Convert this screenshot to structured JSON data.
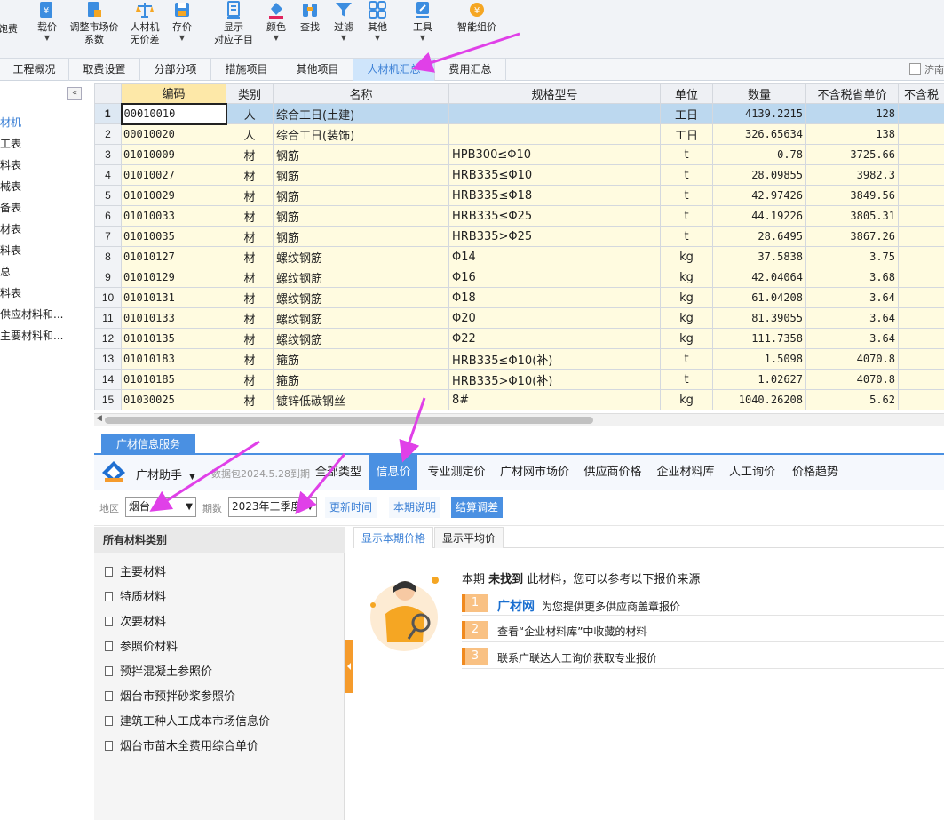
{
  "toolbar": {
    "items": [
      {
        "label": "饱费",
        "icon": "fee-icon"
      },
      {
        "label": "载价",
        "icon": "load-price-icon",
        "dropdown": true
      },
      {
        "label": "调整市场价\n系数",
        "icon": "adjust-coefficient-icon"
      },
      {
        "label": "人材机\n无价差",
        "icon": "balance-icon"
      },
      {
        "label": "存价",
        "icon": "save-price-icon",
        "dropdown": true
      },
      {
        "label": "显示\n对应子目",
        "icon": "show-items-icon"
      },
      {
        "label": "颜色",
        "icon": "color-bucket-icon",
        "dropdown": true
      },
      {
        "label": "查找",
        "icon": "binoculars-icon"
      },
      {
        "label": "过滤",
        "icon": "filter-icon",
        "dropdown": true
      },
      {
        "label": "其他",
        "icon": "grid-apps-icon",
        "dropdown": true
      },
      {
        "label": "工具",
        "icon": "tools-icon",
        "dropdown": true
      },
      {
        "label": "智能组价",
        "icon": "smart-price-icon"
      }
    ]
  },
  "tabs": [
    {
      "label": "工程概况"
    },
    {
      "label": "取费设置"
    },
    {
      "label": "分部分项"
    },
    {
      "label": "措施项目"
    },
    {
      "label": "其他项目"
    },
    {
      "label": "人材机汇总",
      "active": true
    },
    {
      "label": "费用汇总"
    }
  ],
  "tab_checkbox": "济南",
  "left_tree": [
    "材机",
    "工表",
    "料表",
    "械表",
    "备表",
    "材表",
    "料表",
    "总",
    "料表",
    "供应材料和...",
    "主要材料和..."
  ],
  "grid": {
    "headers": [
      "编码",
      "类别",
      "名称",
      "规格型号",
      "单位",
      "数量",
      "不含税省单价",
      "不含税"
    ],
    "rows": [
      {
        "n": "1",
        "code": "00010010",
        "type": "人",
        "name": "综合工日(土建)",
        "spec": "",
        "unit": "工日",
        "qty": "4139.2215",
        "price": "128"
      },
      {
        "n": "2",
        "code": "00010020",
        "type": "人",
        "name": "综合工日(装饰)",
        "spec": "",
        "unit": "工日",
        "qty": "326.65634",
        "price": "138"
      },
      {
        "n": "3",
        "code": "01010009",
        "type": "材",
        "name": "钢筋",
        "spec": "HPB300≤Φ10",
        "unit": "t",
        "qty": "0.78",
        "price": "3725.66"
      },
      {
        "n": "4",
        "code": "01010027",
        "type": "材",
        "name": "钢筋",
        "spec": "HRB335≤Φ10",
        "unit": "t",
        "qty": "28.09855",
        "price": "3982.3"
      },
      {
        "n": "5",
        "code": "01010029",
        "type": "材",
        "name": "钢筋",
        "spec": "HRB335≤Φ18",
        "unit": "t",
        "qty": "42.97426",
        "price": "3849.56"
      },
      {
        "n": "6",
        "code": "01010033",
        "type": "材",
        "name": "钢筋",
        "spec": "HRB335≤Φ25",
        "unit": "t",
        "qty": "44.19226",
        "price": "3805.31"
      },
      {
        "n": "7",
        "code": "01010035",
        "type": "材",
        "name": "钢筋",
        "spec": "HRB335>Φ25",
        "unit": "t",
        "qty": "28.6495",
        "price": "3867.26"
      },
      {
        "n": "8",
        "code": "01010127",
        "type": "材",
        "name": "螺纹钢筋",
        "spec": "Φ14",
        "unit": "kg",
        "qty": "37.5838",
        "price": "3.75"
      },
      {
        "n": "9",
        "code": "01010129",
        "type": "材",
        "name": "螺纹钢筋",
        "spec": "Φ16",
        "unit": "kg",
        "qty": "42.04064",
        "price": "3.68"
      },
      {
        "n": "10",
        "code": "01010131",
        "type": "材",
        "name": "螺纹钢筋",
        "spec": "Φ18",
        "unit": "kg",
        "qty": "61.04208",
        "price": "3.64"
      },
      {
        "n": "11",
        "code": "01010133",
        "type": "材",
        "name": "螺纹钢筋",
        "spec": "Φ20",
        "unit": "kg",
        "qty": "81.39055",
        "price": "3.64"
      },
      {
        "n": "12",
        "code": "01010135",
        "type": "材",
        "name": "螺纹钢筋",
        "spec": "Φ22",
        "unit": "kg",
        "qty": "111.7358",
        "price": "3.64"
      },
      {
        "n": "13",
        "code": "01010183",
        "type": "材",
        "name": "箍筋",
        "spec": "HRB335≤Φ10(补)",
        "unit": "t",
        "qty": "1.5098",
        "price": "4070.8"
      },
      {
        "n": "14",
        "code": "01010185",
        "type": "材",
        "name": "箍筋",
        "spec": "HRB335>Φ10(补)",
        "unit": "t",
        "qty": "1.02627",
        "price": "4070.8"
      },
      {
        "n": "15",
        "code": "01030025",
        "type": "材",
        "name": "镀锌低碳钢丝",
        "spec": "8#",
        "unit": "kg",
        "qty": "1040.26208",
        "price": "5.62"
      }
    ]
  },
  "guangcai": {
    "tab": "广材信息服务",
    "assistant": "广材助手",
    "expire": "数据包2024.5.28到期",
    "nav": [
      {
        "label": "全部类型"
      },
      {
        "label": "信息价",
        "active": true
      },
      {
        "label": "专业测定价"
      },
      {
        "label": "广材网市场价"
      },
      {
        "label": "供应商价格"
      },
      {
        "label": "企业材料库"
      },
      {
        "label": "人工询价"
      },
      {
        "label": "价格趋势"
      }
    ],
    "filter": {
      "region_label": "地区",
      "region": "烟台",
      "period_label": "期数",
      "period": "2023年三季度",
      "btn_update": "更新时间",
      "btn_notes": "本期说明",
      "btn_settle": "结算调差"
    },
    "categories_head": "所有材料类别",
    "categories": [
      "主要材料",
      "特质材料",
      "次要材料",
      "参照价材料",
      "预拌混凝土参照价",
      "烟台市预拌砂浆参照价",
      "建筑工种人工成本市场信息价",
      "烟台市苗木全费用综合单价"
    ],
    "price_tabs": [
      {
        "label": "显示本期价格",
        "active": true
      },
      {
        "label": "显示平均价"
      }
    ],
    "notfound": {
      "pre": "本期",
      "bold": "未找到",
      "post": "此材料，您可以参考以下报价来源"
    },
    "options": [
      {
        "num": "1",
        "logo": "广材网",
        "text": "为您提供更多供应商盖章报价"
      },
      {
        "num": "2",
        "text": "查看“企业材料库”中收藏的材料"
      },
      {
        "num": "3",
        "text": "联系广联达人工询价获取专业报价"
      }
    ]
  },
  "colors": {
    "accent": "#4a90e2",
    "arrow": "#e040e8",
    "row_bg": "#fffbe0",
    "selected_row": "#bcd8ef",
    "orange": "#f59b2c"
  }
}
